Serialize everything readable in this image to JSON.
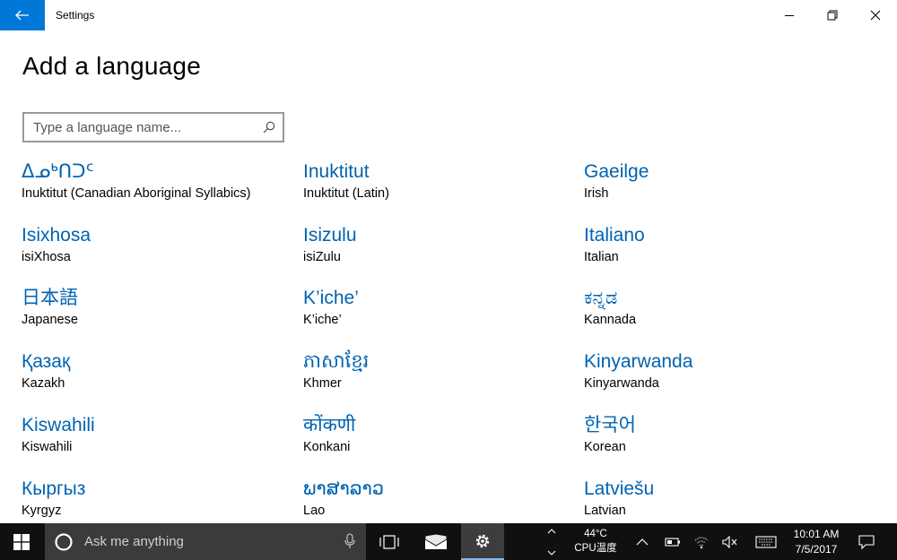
{
  "window": {
    "title": "Settings"
  },
  "page": {
    "title": "Add a language"
  },
  "search": {
    "placeholder": "Type a language name..."
  },
  "languages": [
    {
      "native": "ᐃᓄᒃᑎᑐᑦ",
      "english": "Inuktitut (Canadian Aboriginal Syllabics)"
    },
    {
      "native": "Inuktitut",
      "english": "Inuktitut (Latin)"
    },
    {
      "native": "Gaeilge",
      "english": "Irish"
    },
    {
      "native": "Isixhosa",
      "english": "isiXhosa"
    },
    {
      "native": "Isizulu",
      "english": "isiZulu"
    },
    {
      "native": "Italiano",
      "english": "Italian"
    },
    {
      "native": "日本語",
      "english": "Japanese"
    },
    {
      "native": "K’iche’",
      "english": "K’iche’"
    },
    {
      "native": "ಕನ್ನಡ",
      "english": "Kannada"
    },
    {
      "native": "Қазақ",
      "english": "Kazakh"
    },
    {
      "native": "ភាសាខ្មែរ",
      "english": "Khmer"
    },
    {
      "native": "Kinyarwanda",
      "english": "Kinyarwanda"
    },
    {
      "native": "Kiswahili",
      "english": "Kiswahili"
    },
    {
      "native": "कोंकणी",
      "english": "Konkani"
    },
    {
      "native": "한국어",
      "english": "Korean"
    },
    {
      "native": "Кыргыз",
      "english": "Kyrgyz"
    },
    {
      "native": "ພາສາລາວ",
      "english": "Lao"
    },
    {
      "native": "Latviešu",
      "english": "Latvian"
    }
  ],
  "taskbar": {
    "search_label": "Ask me anything",
    "temperature": "44°C",
    "temp_label": "CPU温度",
    "time": "10:01 AM",
    "date": "7/5/2017"
  },
  "colors": {
    "accent": "#0078d7",
    "link": "#0063b1",
    "taskbar": "#101010"
  },
  "icons": {
    "back": "back-arrow-icon",
    "search": "search-icon",
    "start": "windows-logo-icon",
    "cortana": "cortana-circle-icon",
    "mic": "microphone-icon",
    "task_view": "task-view-icon",
    "mail": "mail-icon",
    "settings": "gear-icon",
    "chevron": "chevron-up-icon",
    "battery": "battery-icon",
    "wifi": "wifi-icon",
    "volume": "volume-muted-icon",
    "keyboard": "keyboard-icon",
    "notifications": "action-center-icon"
  }
}
